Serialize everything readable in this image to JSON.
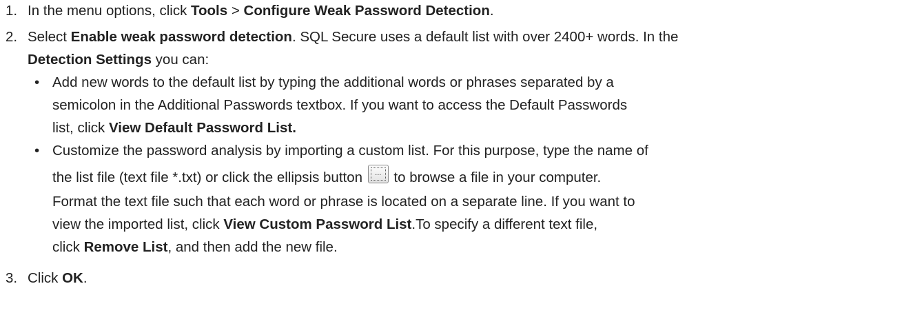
{
  "steps": [
    {
      "number": "1.",
      "pre": "In the menu options, click ",
      "b1": "Tools",
      "mid": " > ",
      "b2": "Configure Weak Password Detection",
      "post": "."
    },
    {
      "number": "2.",
      "pre": "Select ",
      "b1": "Enable weak password detection",
      "post1": ". SQL Secure uses a default list with over 2400+ words. In the",
      "b2": "Detection Settings",
      "post2": " you can:",
      "bullets": [
        {
          "dot": "•",
          "line1": "Add new words to the default list by typing the additional words or phrases separated by a",
          "line2": "semicolon in the Additional Passwords textbox. If you want to access the Default Passwords",
          "line3_pre": "list, click ",
          "line3_b": "View Default Password List."
        },
        {
          "dot": "•",
          "line1": "Customize the password analysis by importing a custom list. For this purpose, type the name of",
          "line2_pre": "the list file (text file *.txt) or click the ellipsis button ",
          "button_glyph": "...",
          "line2_post": " to browse a file in your computer.",
          "line3": "Format the text file such that each word or phrase is located on a separate line. If you want to",
          "line4_pre": "view the imported list, click ",
          "line4_b": "View Custom Password List",
          "line4_post": ".To specify a different text file,",
          "line5_pre": "click ",
          "line5_b": "Remove List",
          "line5_post": ", and then add the new file."
        }
      ]
    },
    {
      "number": "3.",
      "pre": "Click ",
      "b1": "OK",
      "post": "."
    }
  ]
}
